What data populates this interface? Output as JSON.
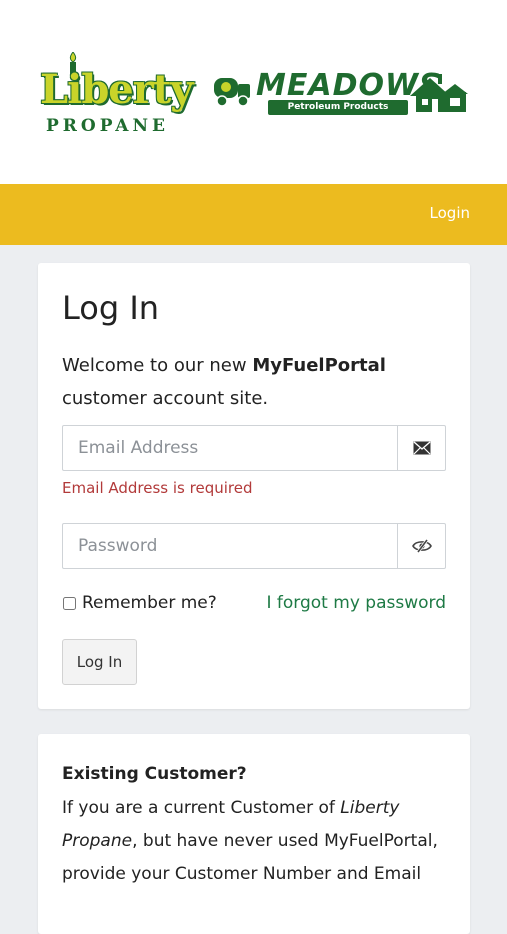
{
  "brand": {
    "liberty_word": "Liberty",
    "propane_word": "PROPANE",
    "meadows_word": "MEADOWS",
    "meadows_sub": "Petroleum Products",
    "liberty_color": "#c9d42a",
    "brand_green": "#1f6b2f"
  },
  "navbar": {
    "login_label": "Login",
    "background_color": "#ecbb1f"
  },
  "login": {
    "title": "Log In",
    "welcome_prefix": "Welcome to our new ",
    "welcome_brand": "MyFuelPortal",
    "welcome_suffix": " customer account site.",
    "email": {
      "placeholder": "Email Address",
      "value": "",
      "icon": "envelope-icon",
      "error": "Email Address is required"
    },
    "password": {
      "placeholder": "Password",
      "value": "",
      "icon": "eye-slash-icon"
    },
    "remember_label": "Remember me?",
    "remember_checked": false,
    "forgot_label": "I forgot my password",
    "submit_label": "Log In"
  },
  "existing": {
    "title": "Existing Customer?",
    "text_1": "If you are a current Customer of ",
    "text_company": "Liberty Propane",
    "text_2": ", but have never used MyFuelPortal, provide your Customer Number and Email"
  }
}
